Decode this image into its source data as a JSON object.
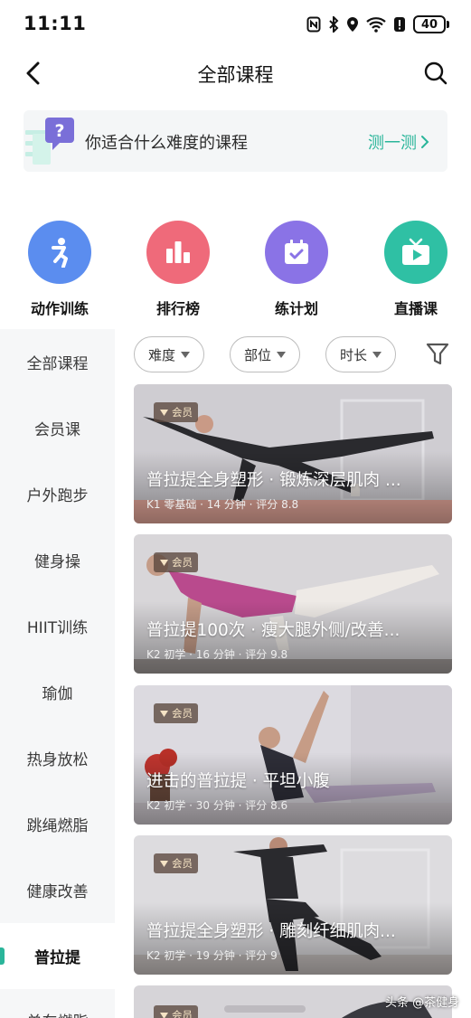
{
  "status_bar": {
    "time": "11:11",
    "battery": "40"
  },
  "header": {
    "title": "全部课程"
  },
  "quiz_banner": {
    "text": "你适合什么难度的课程",
    "link": "测一测"
  },
  "shortcuts": [
    {
      "label": "动作训练",
      "color": "#5b8def",
      "icon": "running-figure-icon"
    },
    {
      "label": "排行榜",
      "color": "#ef6a7a",
      "icon": "bar-chart-icon"
    },
    {
      "label": "练计划",
      "color": "#8a73e6",
      "icon": "calendar-check-icon"
    },
    {
      "label": "直播课",
      "color": "#2fc0a4",
      "icon": "tv-live-icon"
    }
  ],
  "left_nav": {
    "items": [
      "全部课程",
      "会员课",
      "户外跑步",
      "健身操",
      "HIIT训练",
      "瑜伽",
      "热身放松",
      "跳绳燃脂",
      "健康改善",
      "普拉提",
      "单车燃脂"
    ],
    "active": "普拉提",
    "accent": "#2ab59a"
  },
  "filters": {
    "items": [
      "难度",
      "部位",
      "时长"
    ]
  },
  "courses": [
    {
      "badge": "会员",
      "title": "普拉提全身塑形 · 锻炼深层肌肉 ...",
      "meta": "K1 零基础 · 14 分钟 · 评分 8.8"
    },
    {
      "badge": "会员",
      "title": "普拉提100次 · 瘦大腿外侧/改善...",
      "meta": "K2 初学 · 16 分钟 · 评分 9.8"
    },
    {
      "badge": "会员",
      "title": "进击的普拉提 · 平坦小腹",
      "meta": "K2 初学 · 30 分钟 · 评分 8.6"
    },
    {
      "badge": "会员",
      "title": "普拉提全身塑形 · 雕刻纤细肌肉...",
      "meta": "K2 初学 · 19 分钟 · 评分 9"
    },
    {
      "badge": "会员",
      "title": "",
      "meta": ""
    }
  ],
  "watermark": "头条 @茶健身"
}
